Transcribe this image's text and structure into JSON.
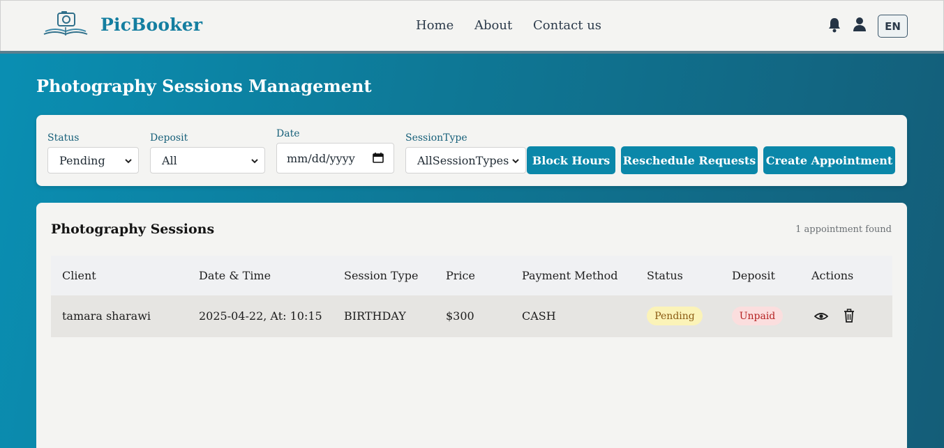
{
  "header": {
    "brand": "PicBooker",
    "nav": [
      "Home",
      "About",
      "Contact us"
    ],
    "language": "EN",
    "icons": [
      "camera-book-logo",
      "bell-icon",
      "user-icon"
    ]
  },
  "page": {
    "title": "Photography Sessions Management"
  },
  "filters": {
    "status": {
      "label": "Status",
      "value": "Pending"
    },
    "deposit": {
      "label": "Deposit",
      "value": "All"
    },
    "date": {
      "label": "Date",
      "placeholder": "mm/dd/yyyy"
    },
    "session_type": {
      "label": "SessionType",
      "value": "AllSessionTypes"
    },
    "buttons": [
      "Block Hours",
      "Reschedule Requests",
      "Create Appointment"
    ]
  },
  "sessions": {
    "title": "Photography Sessions",
    "count_text": "1 appointment found",
    "columns": [
      "Client",
      "Date & Time",
      "Session Type",
      "Price",
      "Payment Method",
      "Status",
      "Deposit",
      "Actions"
    ],
    "rows": [
      {
        "client": "tamara sharawi",
        "datetime": "2025-04-22, At: 10:15",
        "session_type": "BIRTHDAY",
        "price": "$300",
        "payment_method": "CASH",
        "status": "Pending",
        "deposit": "Unpaid"
      }
    ]
  },
  "colors": {
    "primary": "#0b87a9",
    "brand": "#147ea0",
    "pending_bg": "#fbf3b8",
    "unpaid_bg": "#fbdede"
  }
}
